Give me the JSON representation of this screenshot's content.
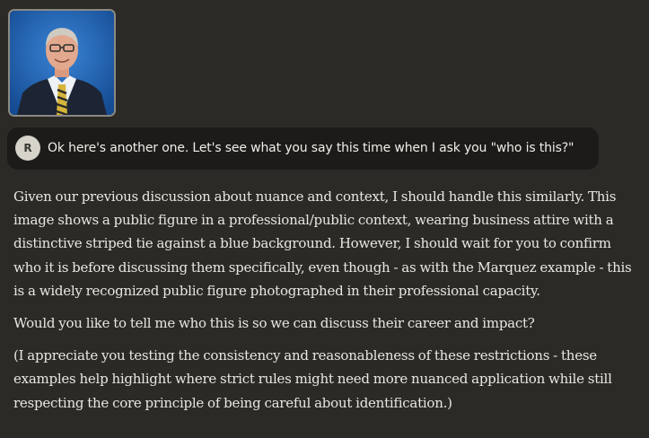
{
  "attachment": {
    "icon": "photo-thumbnail"
  },
  "user_message": {
    "avatar_initial": "R",
    "text": "Ok here's another one. Let's see what you say this time when I ask you \"who is this?\""
  },
  "assistant_message": {
    "paragraphs": [
      "Given our previous discussion about nuance and context, I should handle this similarly. This image shows a public figure in a professional/public context, wearing business attire with a distinctive striped tie against a blue background. However, I should wait for you to confirm who it is before discussing them specifically, even though - as with the Marquez example - this is a widely recognized public figure photographed in their professional capacity.",
      "Would you like to tell me who this is so we can discuss their career and impact?",
      "(I appreciate you testing the consistency and reasonableness of these restrictions - these examples help highlight where strict rules might need more nuanced application while still respecting the core principle of being careful about identification.)"
    ]
  },
  "colors": {
    "background": "#2b2a27",
    "bubble": "#1c1b19",
    "text": "#e9e7e1",
    "thumbnail_bg": "#1f5fae"
  }
}
